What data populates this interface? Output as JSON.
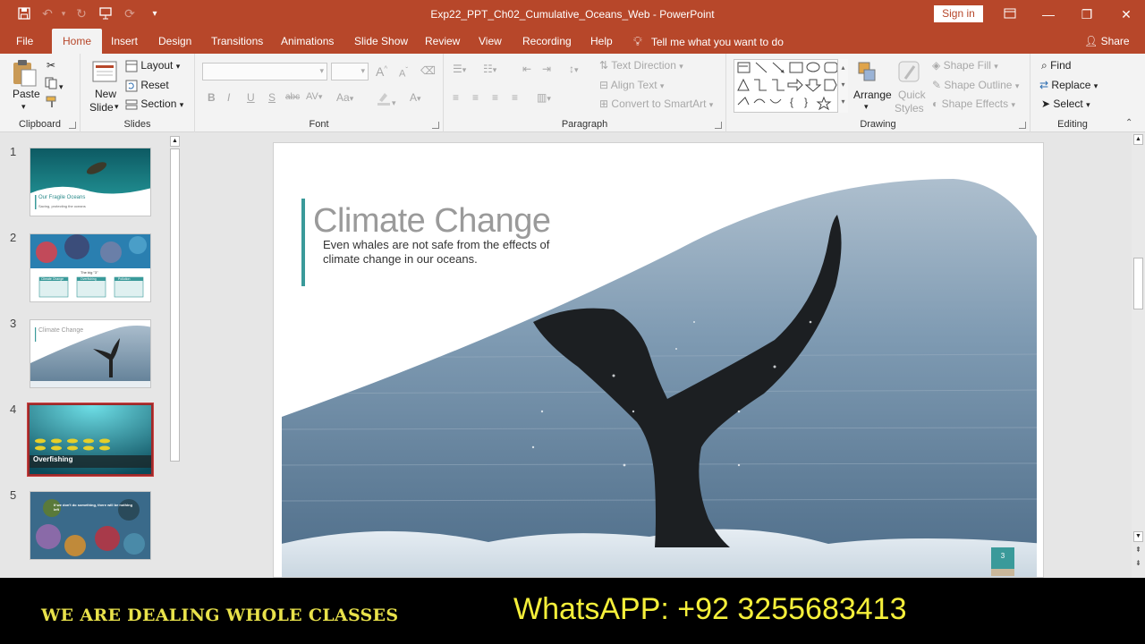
{
  "window": {
    "doc_title": "Exp22_PPT_Ch02_Cumulative_Oceans_Web  -  PowerPoint",
    "sign_in": "Sign in"
  },
  "tabs": [
    "File",
    "Home",
    "Insert",
    "Design",
    "Transitions",
    "Animations",
    "Slide Show",
    "Review",
    "View",
    "Recording",
    "Help"
  ],
  "tell_me": "Tell me what you want to do",
  "share": "Share",
  "ribbon": {
    "clipboard": {
      "paste": "Paste",
      "label": "Clipboard"
    },
    "slides": {
      "new_slide_1": "New",
      "new_slide_2": "Slide",
      "layout": "Layout",
      "reset": "Reset",
      "section": "Section",
      "label": "Slides"
    },
    "font": {
      "label": "Font",
      "bold": "B",
      "italic": "I",
      "underline": "U",
      "shadow": "S",
      "strike": "abc",
      "spacing": "AV",
      "case": "Aa",
      "grow": "A",
      "shrink": "A"
    },
    "paragraph": {
      "label": "Paragraph",
      "text_direction": "Text Direction",
      "align_text": "Align Text",
      "smartart": "Convert to SmartArt"
    },
    "drawing": {
      "label": "Drawing",
      "arrange": "Arrange",
      "quick_styles_1": "Quick",
      "quick_styles_2": "Styles",
      "shape_fill": "Shape Fill",
      "shape_outline": "Shape Outline",
      "shape_effects": "Shape Effects"
    },
    "editing": {
      "label": "Editing",
      "find": "Find",
      "replace": "Replace",
      "select": "Select"
    }
  },
  "thumbnails": [
    {
      "num": "1",
      "title": "Our Fragile Oceans",
      "subtitle": "Saving, protecting the oceans"
    },
    {
      "num": "2",
      "title": "The big \"3\"",
      "cols": [
        "Climate Change",
        "Overfishing",
        "Pollution"
      ]
    },
    {
      "num": "3",
      "title": "Climate Change"
    },
    {
      "num": "4",
      "title": "Overfishing"
    },
    {
      "num": "5",
      "quote": "If we don't do something, there will be nothing left"
    }
  ],
  "slide": {
    "title": "Climate Change",
    "subtitle_line1": "Even whales are not safe from the effects of",
    "subtitle_line2": "climate change in our oceans.",
    "page_number": "3"
  },
  "banner": {
    "left": "WE ARE DEALING WHOLE CLASSES",
    "right": "WhatsAPP:  +92 3255683413"
  },
  "colors": {
    "accent": "#b7472a",
    "slide_accent": "#3a9a9a",
    "banner_text": "#f5ef3a"
  }
}
